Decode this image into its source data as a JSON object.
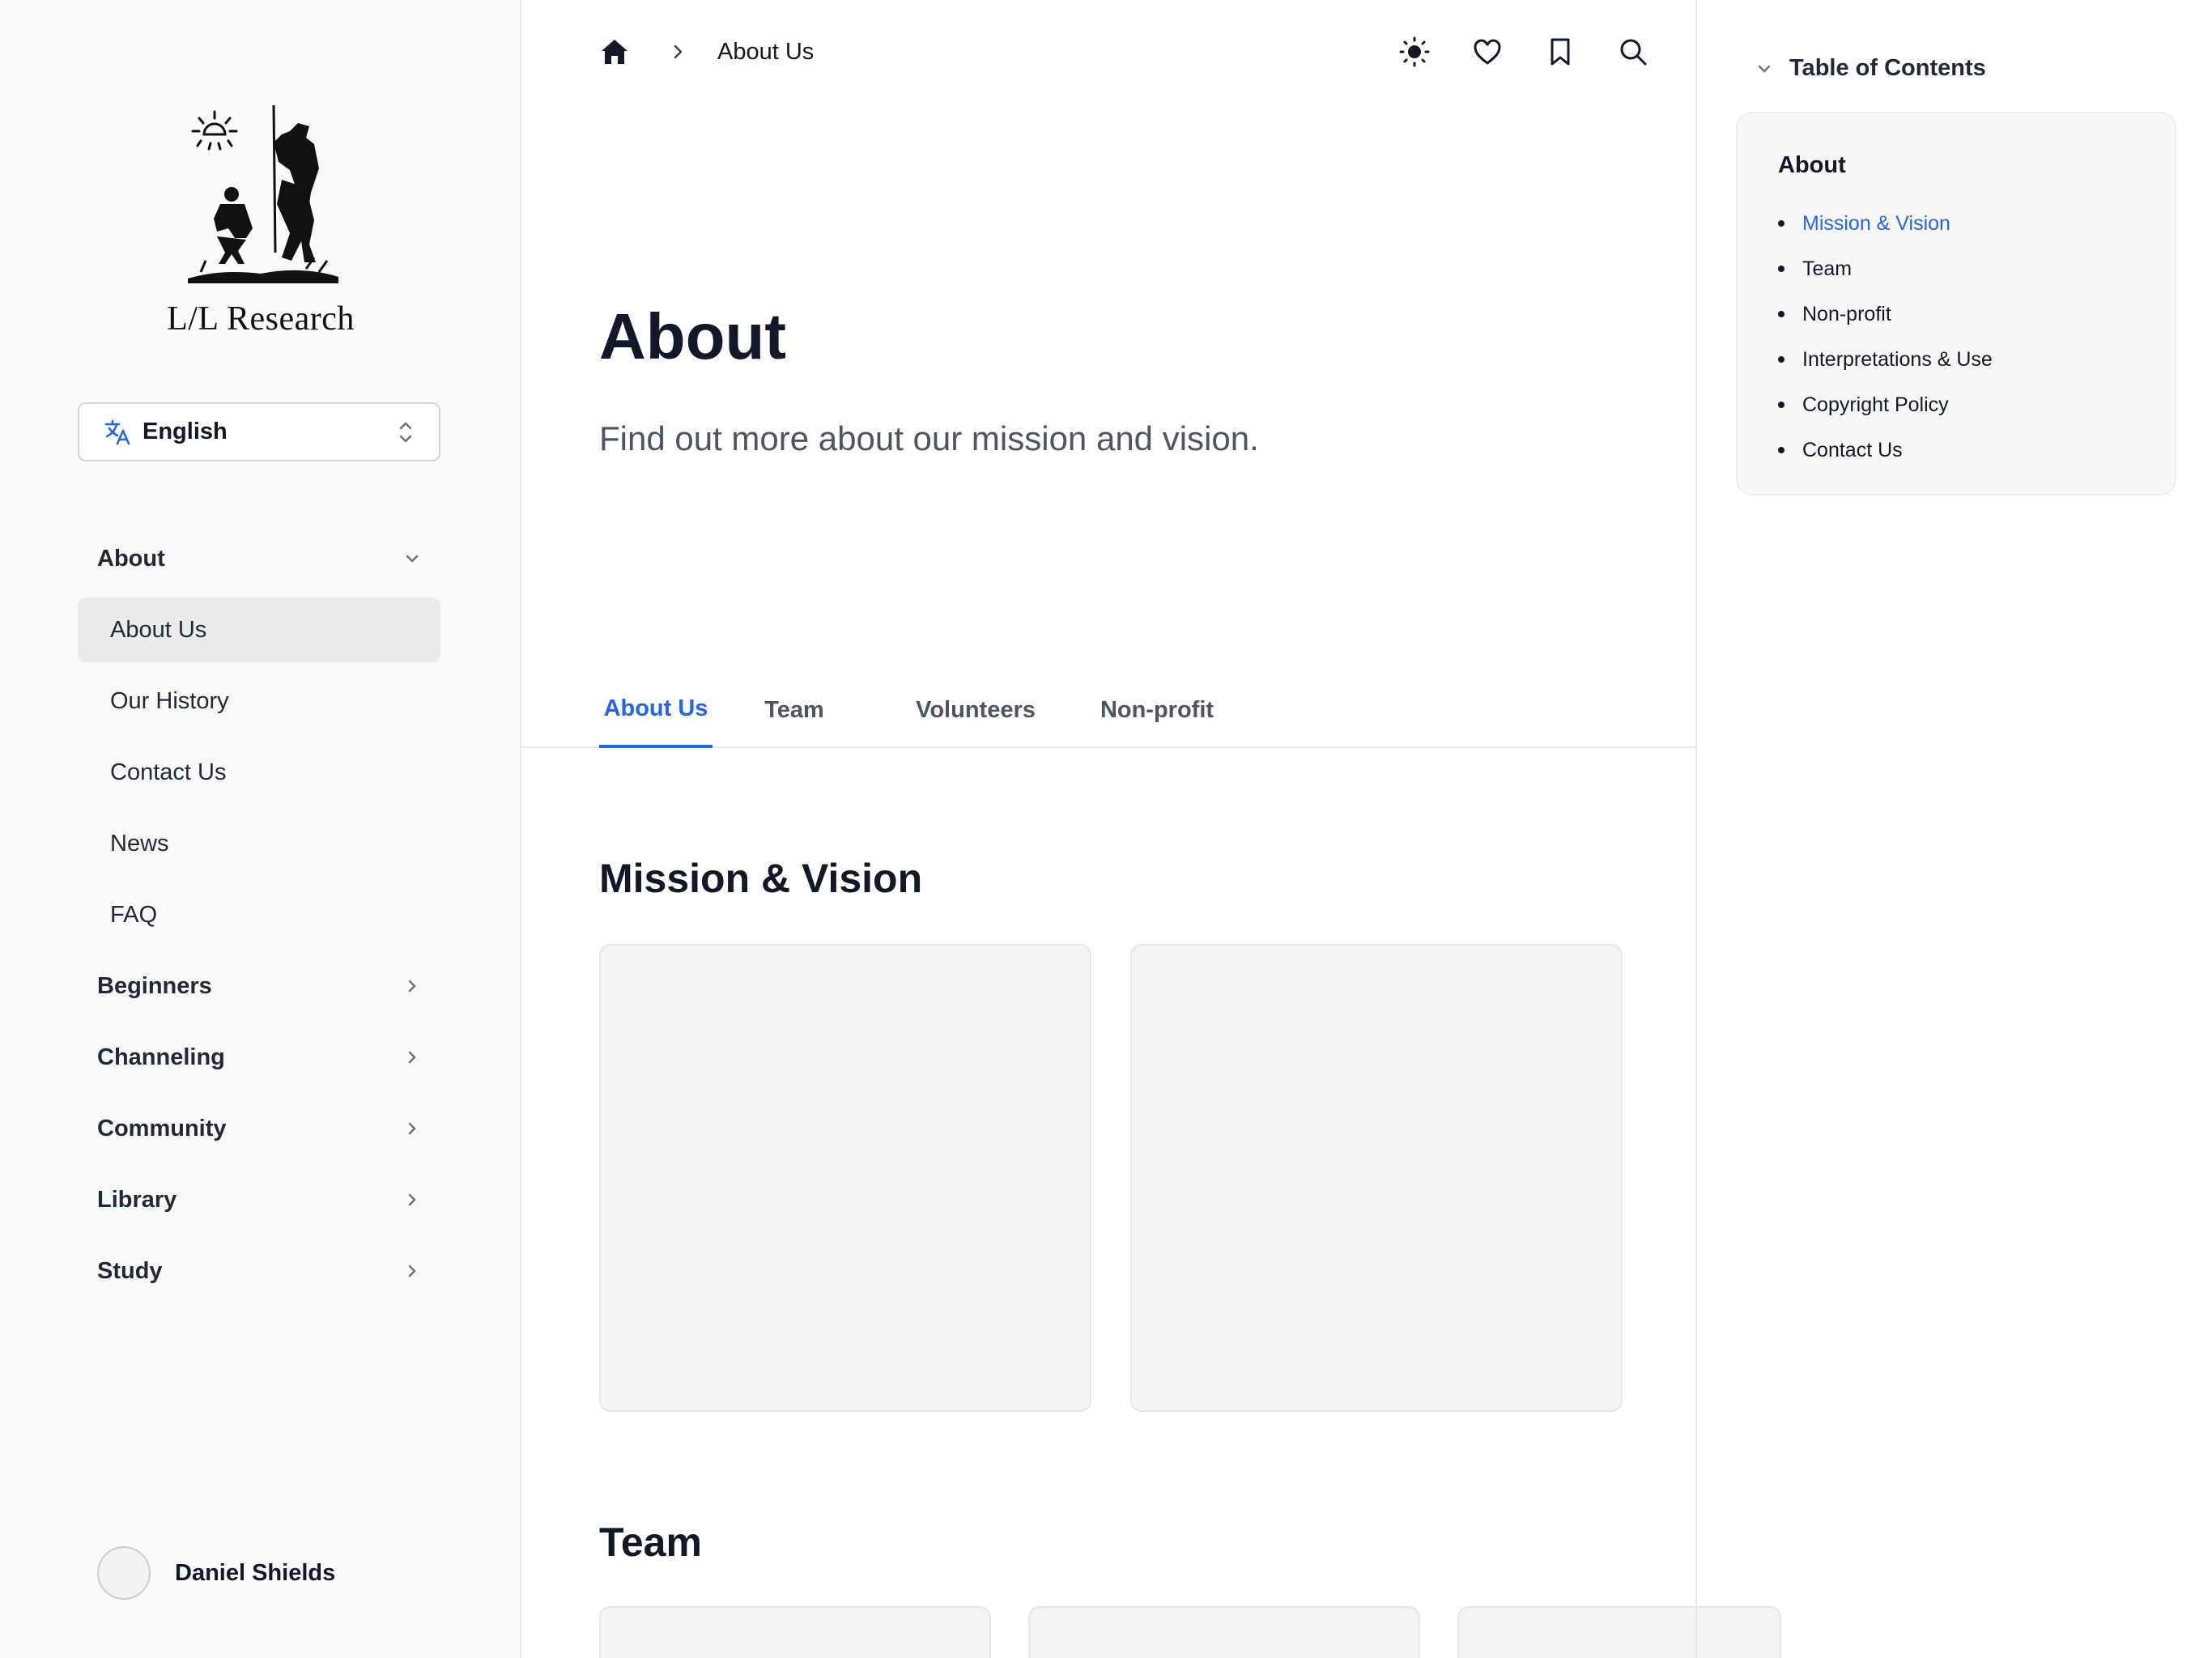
{
  "sidebar": {
    "brand": "L/L Research",
    "language": {
      "value": "English"
    },
    "nav": [
      {
        "label": "About",
        "expanded": true
      },
      {
        "label": "Beginners"
      },
      {
        "label": "Channeling"
      },
      {
        "label": "Community"
      },
      {
        "label": "Library"
      },
      {
        "label": "Study"
      }
    ],
    "about_items": [
      "About Us",
      "Our History",
      "Contact Us",
      "News",
      "FAQ"
    ],
    "active_item": "About Us",
    "user": {
      "name": "Daniel Shields"
    }
  },
  "header": {
    "breadcrumb_current": "About Us",
    "icons": [
      "home-icon",
      "chevron-right-icon",
      "sun-icon",
      "heart-icon",
      "bookmark-icon",
      "search-icon"
    ]
  },
  "main": {
    "title": "About",
    "subtitle": "Find out more about our mission and vision.",
    "tabs": [
      "About Us",
      "Team",
      "Volunteers",
      "Non-profit"
    ],
    "active_tab": "About Us",
    "sections": [
      "Mission & Vision",
      "Team"
    ]
  },
  "toc": {
    "title": "Table of Contents",
    "section": "About",
    "items": [
      "Mission & Vision",
      "Team",
      "Non-profit",
      "Interpretations & Use",
      "Copyright Policy",
      "Contact Us"
    ],
    "active_item": "Mission & Vision"
  },
  "colors": {
    "accent": "#2563eb",
    "sidebar_bg": "#f9f9f9",
    "active_item_bg": "#ebebeb",
    "card_bg": "#f4f4f4"
  }
}
